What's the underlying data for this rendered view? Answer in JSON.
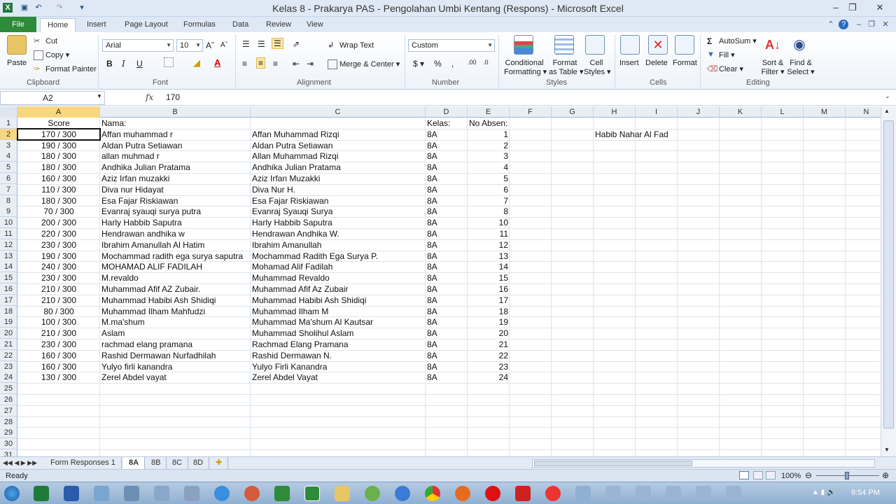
{
  "window": {
    "title": "Kelas 8 - Prakarya PAS - Pengolahan Umbi Kentang (Respons)  -  Microsoft Excel"
  },
  "ribbon_tabs": [
    "File",
    "Home",
    "Insert",
    "Page Layout",
    "Formulas",
    "Data",
    "Review",
    "View"
  ],
  "clipboard": {
    "paste": "Paste",
    "cut": "Cut",
    "copy": "Copy",
    "format_painter": "Format Painter",
    "label": "Clipboard"
  },
  "font": {
    "name": "Arial",
    "size": "10",
    "label": "Font"
  },
  "alignment": {
    "wrap": "Wrap Text",
    "merge": "Merge & Center",
    "label": "Alignment"
  },
  "number": {
    "format": "Custom",
    "label": "Number"
  },
  "styles": {
    "conditional": "Conditional",
    "formatting": "Formatting",
    "format_as": "Format",
    "as_table": "as Table",
    "cell": "Cell",
    "cell_styles": "Styles",
    "label": "Styles"
  },
  "cells": {
    "insert": "Insert",
    "delete": "Delete",
    "format": "Format",
    "label": "Cells"
  },
  "editing": {
    "autosum": "AutoSum",
    "fill": "Fill",
    "clear": "Clear",
    "sort": "Sort &",
    "filter": "Filter",
    "find": "Find &",
    "select": "Select",
    "label": "Editing"
  },
  "formula_bar": {
    "name_box": "A2",
    "fx": "fx",
    "value": "170"
  },
  "columns": [
    "A",
    "B",
    "C",
    "D",
    "E",
    "F",
    "G",
    "H",
    "I",
    "J",
    "K",
    "L",
    "M",
    "N"
  ],
  "row_numbers": [
    "1",
    "2",
    "3",
    "4",
    "5",
    "6",
    "7",
    "8",
    "9",
    "10",
    "11",
    "12",
    "13",
    "14",
    "15",
    "16",
    "17",
    "18",
    "19",
    "20",
    "21",
    "22",
    "23",
    "24",
    "25",
    "26",
    "27",
    "28",
    "29",
    "30",
    "31"
  ],
  "headers": {
    "score": "Score",
    "nama": "Nama:",
    "kelas": "Kelas:",
    "absen": "No Absen:"
  },
  "note_h2": "Habib Nahar Al Fad",
  "rows": [
    {
      "score": "170 / 300",
      "nama": "Affan muhammad r",
      "nama_fix": "Affan Muhammad Rizqi",
      "kelas": "8A",
      "absen": "1"
    },
    {
      "score": "190 / 300",
      "nama": "Aldan Putra Setiawan",
      "nama_fix": "Aldan Putra Setiawan",
      "kelas": "8A",
      "absen": "2"
    },
    {
      "score": "180 / 300",
      "nama": "allan muhmad r",
      "nama_fix": "Allan Muhammad Rizqi",
      "kelas": "8A",
      "absen": "3"
    },
    {
      "score": "180 / 300",
      "nama": "Andhika Julian Pratama",
      "nama_fix": "Andhika Julian Pratama",
      "kelas": "8A",
      "absen": "4"
    },
    {
      "score": "160 / 300",
      "nama": "Aziz Irfan muzakki",
      "nama_fix": "Aziz Irfan Muzakki",
      "kelas": "8A",
      "absen": "5"
    },
    {
      "score": "110 / 300",
      "nama": "Diva nur Hidayat",
      "nama_fix": "Diva Nur H.",
      "kelas": "8A",
      "absen": "6"
    },
    {
      "score": "180 / 300",
      "nama": "Esa Fajar Riskiawan",
      "nama_fix": "Esa Fajar Riskiawan",
      "kelas": "8A",
      "absen": "7"
    },
    {
      "score": "70 / 300",
      "nama": "Evanraj syauqi surya putra",
      "nama_fix": "Evanraj Syauqi Surya",
      "kelas": "8A",
      "absen": "8"
    },
    {
      "score": "200 / 300",
      "nama": "Harly Habbib Saputra",
      "nama_fix": "Harly Habbib Saputra",
      "kelas": "8A",
      "absen": "10"
    },
    {
      "score": "220 / 300",
      "nama": "Hendrawan andhika w",
      "nama_fix": "Hendrawan Andhika W.",
      "kelas": "8A",
      "absen": "11"
    },
    {
      "score": "230 / 300",
      "nama": "Ibrahim Amanullah Al Hatim",
      "nama_fix": "Ibrahim Amanullah",
      "kelas": "8A",
      "absen": "12"
    },
    {
      "score": "190 / 300",
      "nama": "Mochammad radith ega surya saputra",
      "nama_fix": "Mochammad Radith Ega Surya P.",
      "kelas": "8A",
      "absen": "13"
    },
    {
      "score": "240 / 300",
      "nama": "MOHAMAD ALIF FADILAH",
      "nama_fix": "Mohamad Alif Fadilah",
      "kelas": "8A",
      "absen": "14"
    },
    {
      "score": "230 / 300",
      "nama": "M.revaldo",
      "nama_fix": "Muhammad Revaldo",
      "kelas": "8A",
      "absen": "15"
    },
    {
      "score": "210 / 300",
      "nama": "Muhammad Afif AZ Zubair.",
      "nama_fix": "Muhammad Afif Az Zubair",
      "kelas": "8A",
      "absen": "16"
    },
    {
      "score": "210 / 300",
      "nama": "Muhammad Habibi Ash Shidiqi",
      "nama_fix": "Muhammad Habibi Ash Shidiqi",
      "kelas": "8A",
      "absen": "17"
    },
    {
      "score": "80 / 300",
      "nama": "Muhammad Ilham Mahfudzi",
      "nama_fix": "Muhammad Ilham M",
      "kelas": "8A",
      "absen": "18"
    },
    {
      "score": "100 / 300",
      "nama": "M.ma'shum",
      "nama_fix": "Muhammad Ma'shum Al Kautsar",
      "kelas": "8A",
      "absen": "19"
    },
    {
      "score": "210 / 300",
      "nama": "Aslam",
      "nama_fix": "Muhammad Sholihul Aslam",
      "kelas": "8A",
      "absen": "20"
    },
    {
      "score": "230 / 300",
      "nama": "rachmad elang pramana",
      "nama_fix": "Rachmad Elang Pramana",
      "kelas": "8A",
      "absen": "21"
    },
    {
      "score": "160 / 300",
      "nama": "Rashid Dermawan Nurfadhilah",
      "nama_fix": "Rashid Dermawan N.",
      "kelas": "8A",
      "absen": "22"
    },
    {
      "score": "160 / 300",
      "nama": "Yulyo firli kanandra",
      "nama_fix": "Yulyo Firli Kanandra",
      "kelas": "8A",
      "absen": "23"
    },
    {
      "score": "130 / 300",
      "nama": "Zerel Abdel vayat",
      "nama_fix": "Zerel Abdel Vayat",
      "kelas": "8A",
      "absen": "24"
    }
  ],
  "sheets": [
    "Form Responses 1",
    "8A",
    "8B",
    "8C",
    "8D"
  ],
  "status": {
    "ready": "Ready",
    "zoom": "100%"
  },
  "clock": "9:54 PM",
  "colors": {
    "file_tab": "#2e8b3a",
    "selected_header": "#f9d77e",
    "ribbon_bg": "#dfe9f5"
  }
}
